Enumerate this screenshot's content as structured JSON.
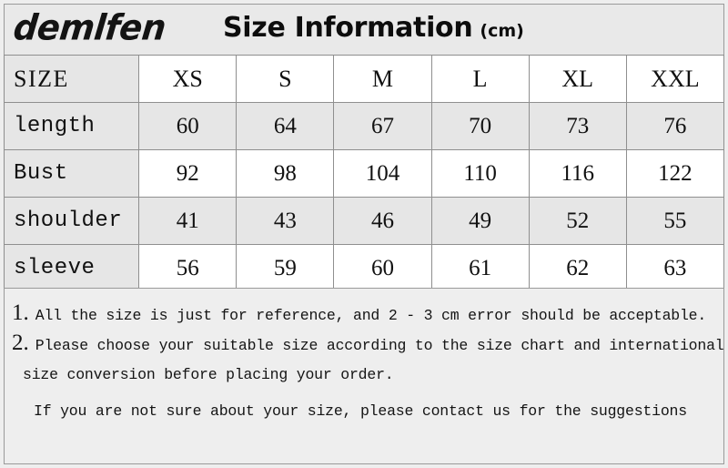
{
  "header": {
    "brand": "demlfen",
    "title": "Size Information",
    "unit": "(cm)"
  },
  "table": {
    "columns": [
      "SIZE",
      "XS",
      "S",
      "M",
      "L",
      "XL",
      "XXL"
    ],
    "rows": [
      {
        "label": "length",
        "values": [
          "60",
          "64",
          "67",
          "70",
          "73",
          "76"
        ]
      },
      {
        "label": "Bust",
        "values": [
          "92",
          "98",
          "104",
          "110",
          "116",
          "122"
        ]
      },
      {
        "label": "shoulder",
        "values": [
          "41",
          "43",
          "46",
          "49",
          "52",
          "55"
        ]
      },
      {
        "label": "sleeve",
        "values": [
          "56",
          "59",
          "60",
          "61",
          "62",
          "63"
        ]
      }
    ]
  },
  "notes": {
    "items": [
      {
        "number": "1.",
        "lines": [
          "All the size is just for reference, and 2 - 3 cm error should be acceptable."
        ]
      },
      {
        "number": "2.",
        "lines": [
          "Please choose your suitable size according to the size chart and international",
          "size conversion before placing your order."
        ]
      }
    ],
    "closing": "If you are not sure about your size, please contact us for the suggestions"
  },
  "colors": {
    "page_background": "#eeeeee",
    "shaded_cell": "#e6e6e6",
    "plain_cell": "#ffffff",
    "border": "#8f8f8f",
    "text": "#111111"
  }
}
